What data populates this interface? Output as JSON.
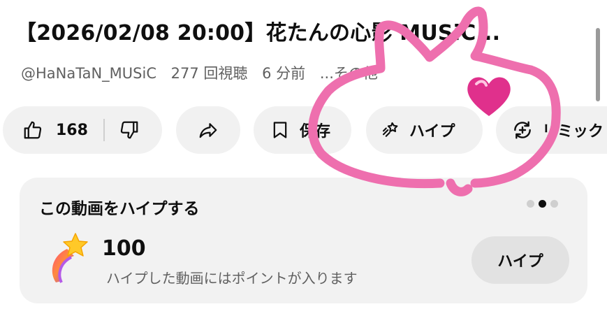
{
  "video": {
    "title": "【2026/02/08 20:00】花たんの心影 MUSiC...",
    "channel": "@HaNaTaN_MUSiC",
    "views": "277 回視聴",
    "time_ago": "6 分前",
    "tag": "...その他"
  },
  "actions": {
    "like_count": "168",
    "save_label": "保存",
    "hype_label": "ハイプ",
    "remix_label": "リミック"
  },
  "hype_card": {
    "title": "この動画をハイプする",
    "points": "100",
    "description": "ハイプした動画にはポイントが入ります",
    "button_label": "ハイプ",
    "pager_active_index": 1,
    "pager_count": 3
  },
  "icons": {
    "like": "thumbs-up-icon",
    "dislike": "thumbs-down-icon",
    "share": "share-arrow-icon",
    "save": "bookmark-icon",
    "hype": "hype-rocket-icon",
    "remix": "remix-icon",
    "hype_star": "shooting-star-icon",
    "heart": "pink-heart-emoji"
  },
  "colors": {
    "doodle_pink": "#ee6fae",
    "heart_pink": "#e0308c"
  }
}
